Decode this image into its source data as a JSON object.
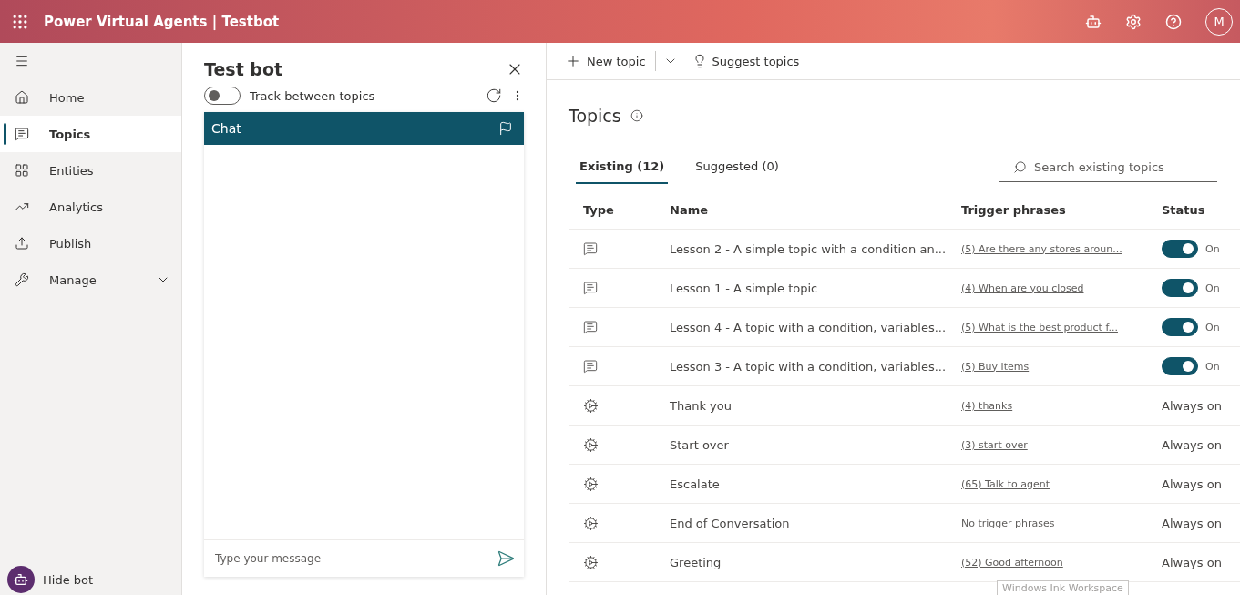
{
  "header": {
    "title": "Power Virtual Agents | Testbot",
    "avatar": "M"
  },
  "sidebar": {
    "items": [
      {
        "label": "Home",
        "selected": false,
        "expandable": false
      },
      {
        "label": "Topics",
        "selected": true,
        "expandable": false
      },
      {
        "label": "Entities",
        "selected": false,
        "expandable": false
      },
      {
        "label": "Analytics",
        "selected": false,
        "expandable": false
      },
      {
        "label": "Publish",
        "selected": false,
        "expandable": false
      },
      {
        "label": "Manage",
        "selected": false,
        "expandable": true
      }
    ],
    "footer": "Hide bot"
  },
  "test_bot": {
    "title": "Test bot",
    "track": {
      "label": "Track between topics",
      "on": false
    },
    "chat_title": "Chat",
    "input": {
      "placeholder": "Type your message"
    }
  },
  "toolbar": {
    "new_topic": "New topic",
    "suggest": "Suggest topics"
  },
  "topics": {
    "title": "Topics",
    "tabs": [
      {
        "label": "Existing (12)",
        "selected": true
      },
      {
        "label": "Suggested (0)",
        "selected": false
      }
    ],
    "search": {
      "placeholder": "Search existing topics"
    },
    "columns": [
      "Type",
      "Name",
      "Trigger phrases",
      "Status"
    ],
    "rows": [
      {
        "kind": "custom",
        "name": "Lesson 2 - A simple topic with a condition an...",
        "trigger": "(5) Are there any stores aroun...",
        "trigger_link": true,
        "status": {
          "kind": "toggle",
          "on": true,
          "label": "On"
        }
      },
      {
        "kind": "custom",
        "name": "Lesson 1 - A simple topic",
        "trigger": "(4) When are you closed",
        "trigger_link": true,
        "status": {
          "kind": "toggle",
          "on": true,
          "label": "On"
        }
      },
      {
        "kind": "custom",
        "name": "Lesson 4 - A topic with a condition, variables...",
        "trigger": "(5) What is the best product f...",
        "trigger_link": true,
        "status": {
          "kind": "toggle",
          "on": true,
          "label": "On"
        }
      },
      {
        "kind": "custom",
        "name": "Lesson 3 - A topic with a condition, variables...",
        "trigger": "(5) Buy items",
        "trigger_link": true,
        "status": {
          "kind": "toggle",
          "on": true,
          "label": "On"
        }
      },
      {
        "kind": "system",
        "name": "Thank you",
        "trigger": "(4) thanks",
        "trigger_link": true,
        "status": {
          "kind": "text",
          "label": "Always on"
        }
      },
      {
        "kind": "system",
        "name": "Start over",
        "trigger": "(3) start over",
        "trigger_link": true,
        "status": {
          "kind": "text",
          "label": "Always on"
        }
      },
      {
        "kind": "system",
        "name": "Escalate",
        "trigger": "(65) Talk to agent",
        "trigger_link": true,
        "status": {
          "kind": "text",
          "label": "Always on"
        }
      },
      {
        "kind": "system",
        "name": "End of Conversation",
        "trigger": "No trigger phrases",
        "trigger_link": false,
        "status": {
          "kind": "text",
          "label": "Always on"
        }
      },
      {
        "kind": "system",
        "name": "Greeting",
        "trigger": "(52) Good afternoon",
        "trigger_link": true,
        "status": {
          "kind": "text",
          "label": "Always on"
        }
      }
    ]
  },
  "tooltip": "Windows Ink Workspace"
}
